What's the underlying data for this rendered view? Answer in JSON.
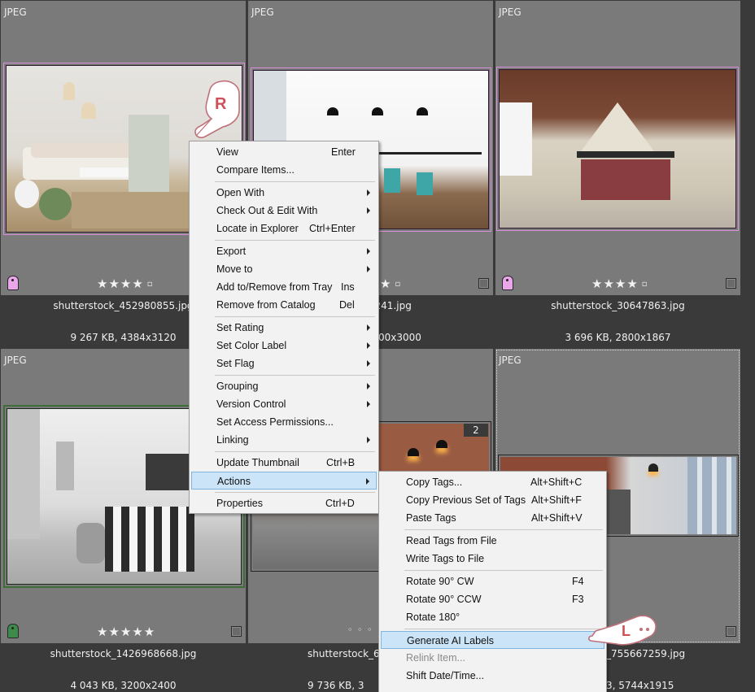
{
  "tiles": [
    {
      "format": "JPEG",
      "filename": "shutterstock_452980855.jpg",
      "info": "9 267 KB, 4384x3120",
      "rating": "★★★★",
      "color_label": "#e9a7e9"
    },
    {
      "format": "JPEG",
      "filename": "0807241.jpg",
      "info": "00x3000",
      "rating": "★"
    },
    {
      "format": "JPEG",
      "filename": "shutterstock_30647863.jpg",
      "info": "3 696 KB, 2800x1867",
      "rating": "★★★★",
      "color_label": "#e9a7e9"
    },
    {
      "format": "JPEG",
      "filename": "shutterstock_1426968668.jpg",
      "info": "4 043 KB, 3200x2400",
      "rating": "★★★★★",
      "color_label": "#3e8a4a"
    },
    {
      "format": "",
      "filename": "shutterstock_688",
      "info": "9 736 KB, 3",
      "rating": "◦ ◦ ◦",
      "stack_count": "2"
    },
    {
      "format": "JPEG",
      "filename": "_755667259.jpg",
      "info": "3, 5744x1915",
      "rating": ""
    }
  ],
  "context_menu": {
    "items": [
      {
        "label": "View",
        "shortcut": "Enter"
      },
      {
        "label": "Compare Items..."
      },
      {
        "label": "Open With",
        "submenu": true
      },
      {
        "label": "Check Out & Edit With",
        "submenu": true
      },
      {
        "label": "Locate in Explorer",
        "shortcut": "Ctrl+Enter"
      },
      {
        "label": "Export",
        "submenu": true
      },
      {
        "label": "Move to",
        "submenu": true
      },
      {
        "label": "Add to/Remove from Tray",
        "shortcut": "Ins"
      },
      {
        "label": "Remove from Catalog",
        "shortcut": "Del"
      },
      {
        "label": "Set Rating",
        "submenu": true
      },
      {
        "label": "Set Color Label",
        "submenu": true
      },
      {
        "label": "Set Flag",
        "submenu": true
      },
      {
        "label": "Grouping",
        "submenu": true
      },
      {
        "label": "Version Control",
        "submenu": true
      },
      {
        "label": "Set Access Permissions..."
      },
      {
        "label": "Linking",
        "submenu": true
      },
      {
        "label": "Update Thumbnail",
        "shortcut": "Ctrl+B"
      },
      {
        "label": "Actions",
        "submenu": true,
        "highlighted": true
      },
      {
        "label": "Properties",
        "shortcut": "Ctrl+D"
      }
    ]
  },
  "actions_submenu": {
    "items": [
      {
        "label": "Copy Tags...",
        "shortcut": "Alt+Shift+C"
      },
      {
        "label": "Copy Previous Set of Tags",
        "shortcut": "Alt+Shift+F"
      },
      {
        "label": "Paste Tags",
        "shortcut": "Alt+Shift+V"
      },
      {
        "label": "Read Tags from File"
      },
      {
        "label": "Write Tags to File"
      },
      {
        "label": "Rotate 90° CW",
        "shortcut": "F4"
      },
      {
        "label": "Rotate 90° CCW",
        "shortcut": "F3"
      },
      {
        "label": "Rotate 180°"
      },
      {
        "label": "Generate AI Labels",
        "highlighted": true
      },
      {
        "label": "Relink Item...",
        "disabled": true
      },
      {
        "label": "Shift Date/Time..."
      }
    ]
  },
  "cursor_hints": {
    "right_click": "R",
    "left_click": "L"
  }
}
